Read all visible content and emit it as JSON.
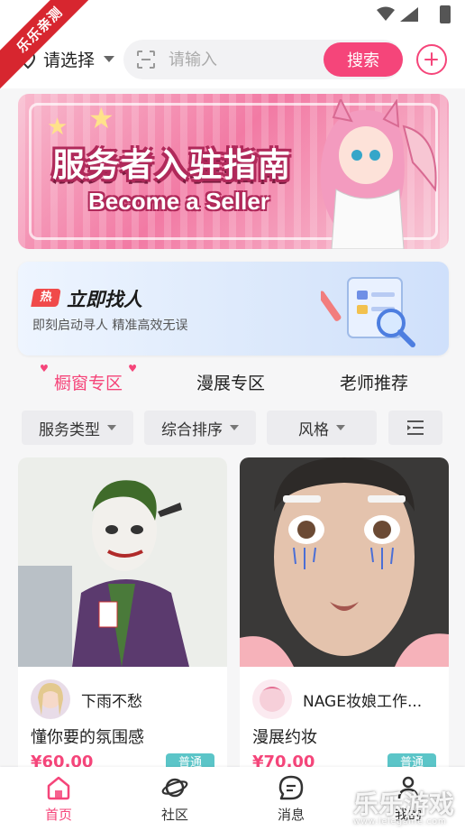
{
  "ribbon": {
    "text": "乐乐亲测"
  },
  "header": {
    "location": "请选择",
    "search_placeholder": "请输入",
    "search_button": "搜索"
  },
  "banner": {
    "title_cn": "服务者入驻指南",
    "title_en": "Become a Seller"
  },
  "find": {
    "hot_badge": "热",
    "title": "立即找人",
    "subtitle": "即刻启动寻人 精准高效无误"
  },
  "tabs": [
    {
      "label": "橱窗专区",
      "active": true
    },
    {
      "label": "漫展专区",
      "active": false
    },
    {
      "label": "老师推荐",
      "active": false
    }
  ],
  "filters": [
    {
      "label": "服务类型"
    },
    {
      "label": "综合排序"
    },
    {
      "label": "风格"
    }
  ],
  "cards": [
    {
      "user": "下雨不愁",
      "title": "懂你要的氛围感",
      "price": "¥60.00",
      "tag": "普通"
    },
    {
      "user": "NAGE妆娘工作...",
      "title": "漫展约妆",
      "price": "¥70.00",
      "tag": "普通"
    }
  ],
  "nav": [
    {
      "label": "首页",
      "icon": "home-icon",
      "active": true
    },
    {
      "label": "社区",
      "icon": "planet-icon",
      "active": false
    },
    {
      "label": "消息",
      "icon": "message-icon",
      "active": false
    },
    {
      "label": "我的",
      "icon": "profile-icon",
      "active": false
    }
  ],
  "watermark": {
    "text": "乐乐游戏",
    "url": "www.lelegame.com"
  },
  "colors": {
    "accent": "#f5457a",
    "tag": "#5bc5c8",
    "hot": "#f04a4a"
  }
}
